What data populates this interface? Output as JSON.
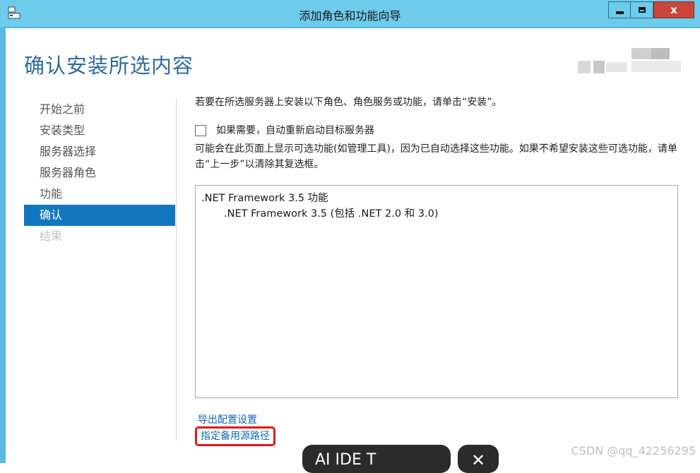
{
  "window": {
    "title": "添加角色和功能向导",
    "close_glyph": "x"
  },
  "page": {
    "title": "确认安装所选内容"
  },
  "nav": {
    "items": [
      {
        "label": "开始之前"
      },
      {
        "label": "安装类型"
      },
      {
        "label": "服务器选择"
      },
      {
        "label": "服务器角色"
      },
      {
        "label": "功能"
      },
      {
        "label": "确认"
      },
      {
        "label": "结果"
      }
    ]
  },
  "content": {
    "intro": "若要在所选服务器上安装以下角色、角色服务或功能，请单击“安装”。",
    "restart_checkbox_label": "如果需要，自动重新启动目标服务器",
    "restart_checked": false,
    "note": "可能会在此页面上显示可选功能(如管理工具)，因为已自动选择这些功能。如果不希望安装这些可选功能，请单击“上一步”以清除其复选框。",
    "features": [
      {
        "label": ".NET Framework 3.5 功能",
        "level": 0
      },
      {
        "label": ".NET Framework 3.5 (包括 .NET 2.0 和 3.0)",
        "level": 1
      }
    ],
    "export_link": "导出配置设置",
    "alt_source_link": "指定备用源路径"
  },
  "watermark": "CSDN @qq_42256295",
  "overlay": {
    "left_text": "AI IDE T",
    "right_text": "✕"
  },
  "colors": {
    "titlebar": "#6dcbeb",
    "accent": "#1377c0",
    "link": "#1568b2",
    "highlight_box": "#e01818"
  }
}
